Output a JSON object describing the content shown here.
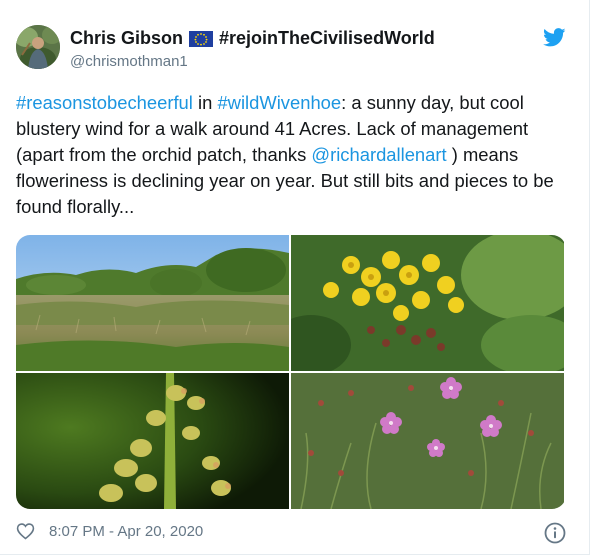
{
  "author": {
    "name": "Chris Gibson",
    "flag_icon": "eu-flag-icon",
    "hashtag_name": "#rejoinTheCivilisedWorld",
    "handle": "@chrismothman1"
  },
  "tweet": {
    "segments": [
      {
        "text": "#reasonstobecheerful",
        "link": true
      },
      {
        "text": " in ",
        "link": false
      },
      {
        "text": "#wildWivenhoe",
        "link": true
      },
      {
        "text": ": a sunny day, but cool blustery wind for a walk around 41 Acres. Lack of management (apart from the orchid patch, thanks ",
        "link": false
      },
      {
        "text": "@richardallenart",
        "link": true
      },
      {
        "text": " ) means floweriness is declining year on year. But still bits and pieces to be found florally...",
        "link": false
      }
    ]
  },
  "photos": [
    {
      "name": "meadow-photo",
      "subject": "scrubby meadow landscape under blue sky"
    },
    {
      "name": "yellow-flowers-photo",
      "subject": "yellow wildflower cluster"
    },
    {
      "name": "buds-closeup-photo",
      "subject": "close-up of green flower buds"
    },
    {
      "name": "pink-flowers-photo",
      "subject": "small pink wildflowers in grass"
    }
  ],
  "footer": {
    "timestamp": "8:07 PM - Apr 20, 2020",
    "like_icon": "heart-icon",
    "info_icon": "info-icon"
  },
  "colors": {
    "link": "#1b95e0",
    "twitter_blue": "#1da1f2",
    "muted": "#657786",
    "text": "#14171a"
  }
}
